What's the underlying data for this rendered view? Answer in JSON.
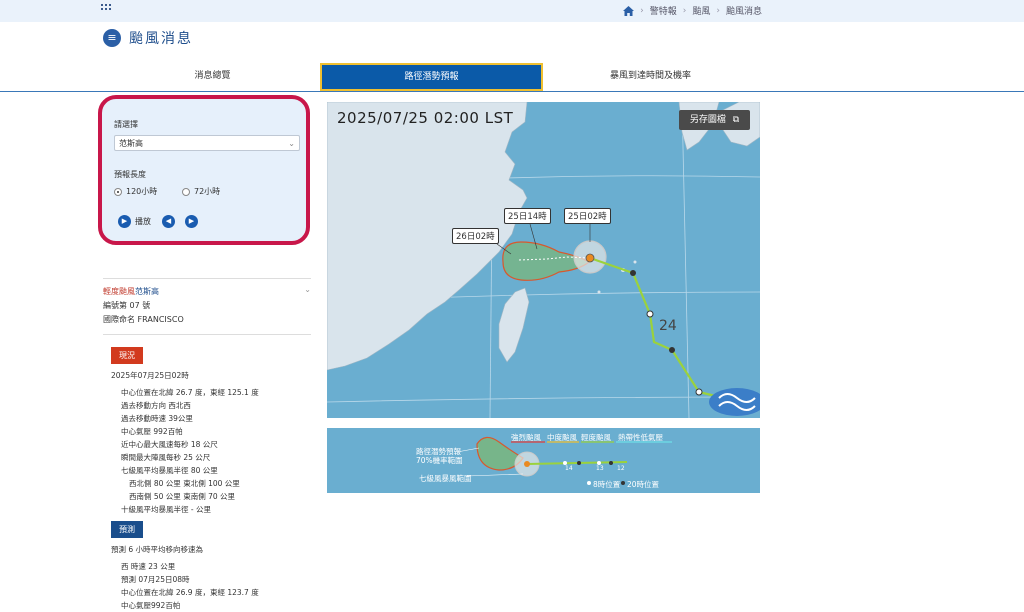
{
  "breadcrumb": {
    "items": [
      "警特報",
      "颱風",
      "颱風消息"
    ]
  },
  "page": {
    "title": "颱風消息"
  },
  "tabs": [
    {
      "label": "消息總覽"
    },
    {
      "label": "路徑潛勢預報"
    },
    {
      "label": "暴風到達時間及機率"
    }
  ],
  "selector": {
    "select_label": "請選擇",
    "selected_storm": "范斯高",
    "length_label": "預報長度",
    "option_120": "120小時",
    "option_72": "72小時",
    "play_label": "播放"
  },
  "storm": {
    "name_prefix": "輕度颱風",
    "name": "范斯高",
    "number": "編號第 07 號",
    "intl_name": "國際命名 FRANCISCO"
  },
  "current": {
    "badge": "現況",
    "time": "2025年07月25日02時",
    "lines": [
      "中心位置在北緯 26.7 度，東經 125.1 度",
      "過去移動方向 西北西",
      "過去移動時速 39公里",
      "中心氣壓 992百帕",
      "近中心最大風速每秒 18 公尺",
      "瞬間最大陣風每秒 25 公尺",
      "七級風平均暴風半徑 80 公里"
    ],
    "sub_lines": [
      "西北側 80 公里 東北側 100 公里",
      "西南側 50 公里 東南側 70 公里"
    ],
    "last_line": "十級風平均暴風半徑 - 公里"
  },
  "forecast": {
    "badge": "預測",
    "speed_line": "預測 6 小時平均移向移速為",
    "speed_detail": "西 時速 23 公里",
    "time_line": "預測 07月25日08時",
    "pos_line": "中心位置在北緯 26.9 度，東經 123.7 度",
    "partial_line": "中心氣壓992百帕"
  },
  "map": {
    "timestamp": "2025/07/25 02:00 LST",
    "save_button": "另存圖檔",
    "label_26": "26日02時",
    "label_25_14": "25日14時",
    "label_25_02": "25日02時",
    "track_number": "24"
  },
  "legend": {
    "potential": "路徑潛勢預報",
    "probability": "70%機率範圍",
    "gale": "七級風暴風範圍",
    "strong": "強烈颱風",
    "medium": "中度颱風",
    "light": "輕度颱風",
    "tropical": "熱帶性低氣壓",
    "h8": "8時位置",
    "h20": "20時位置",
    "n14": "14",
    "n13": "13",
    "n12": "12"
  },
  "colors": {
    "accent": "#0b5aa8",
    "highlight_border": "#c8174a",
    "active_tab_border": "#f0c030",
    "sea": "#6aaed0",
    "land": "#d9e4ec",
    "track_light": "#9bd23c"
  }
}
